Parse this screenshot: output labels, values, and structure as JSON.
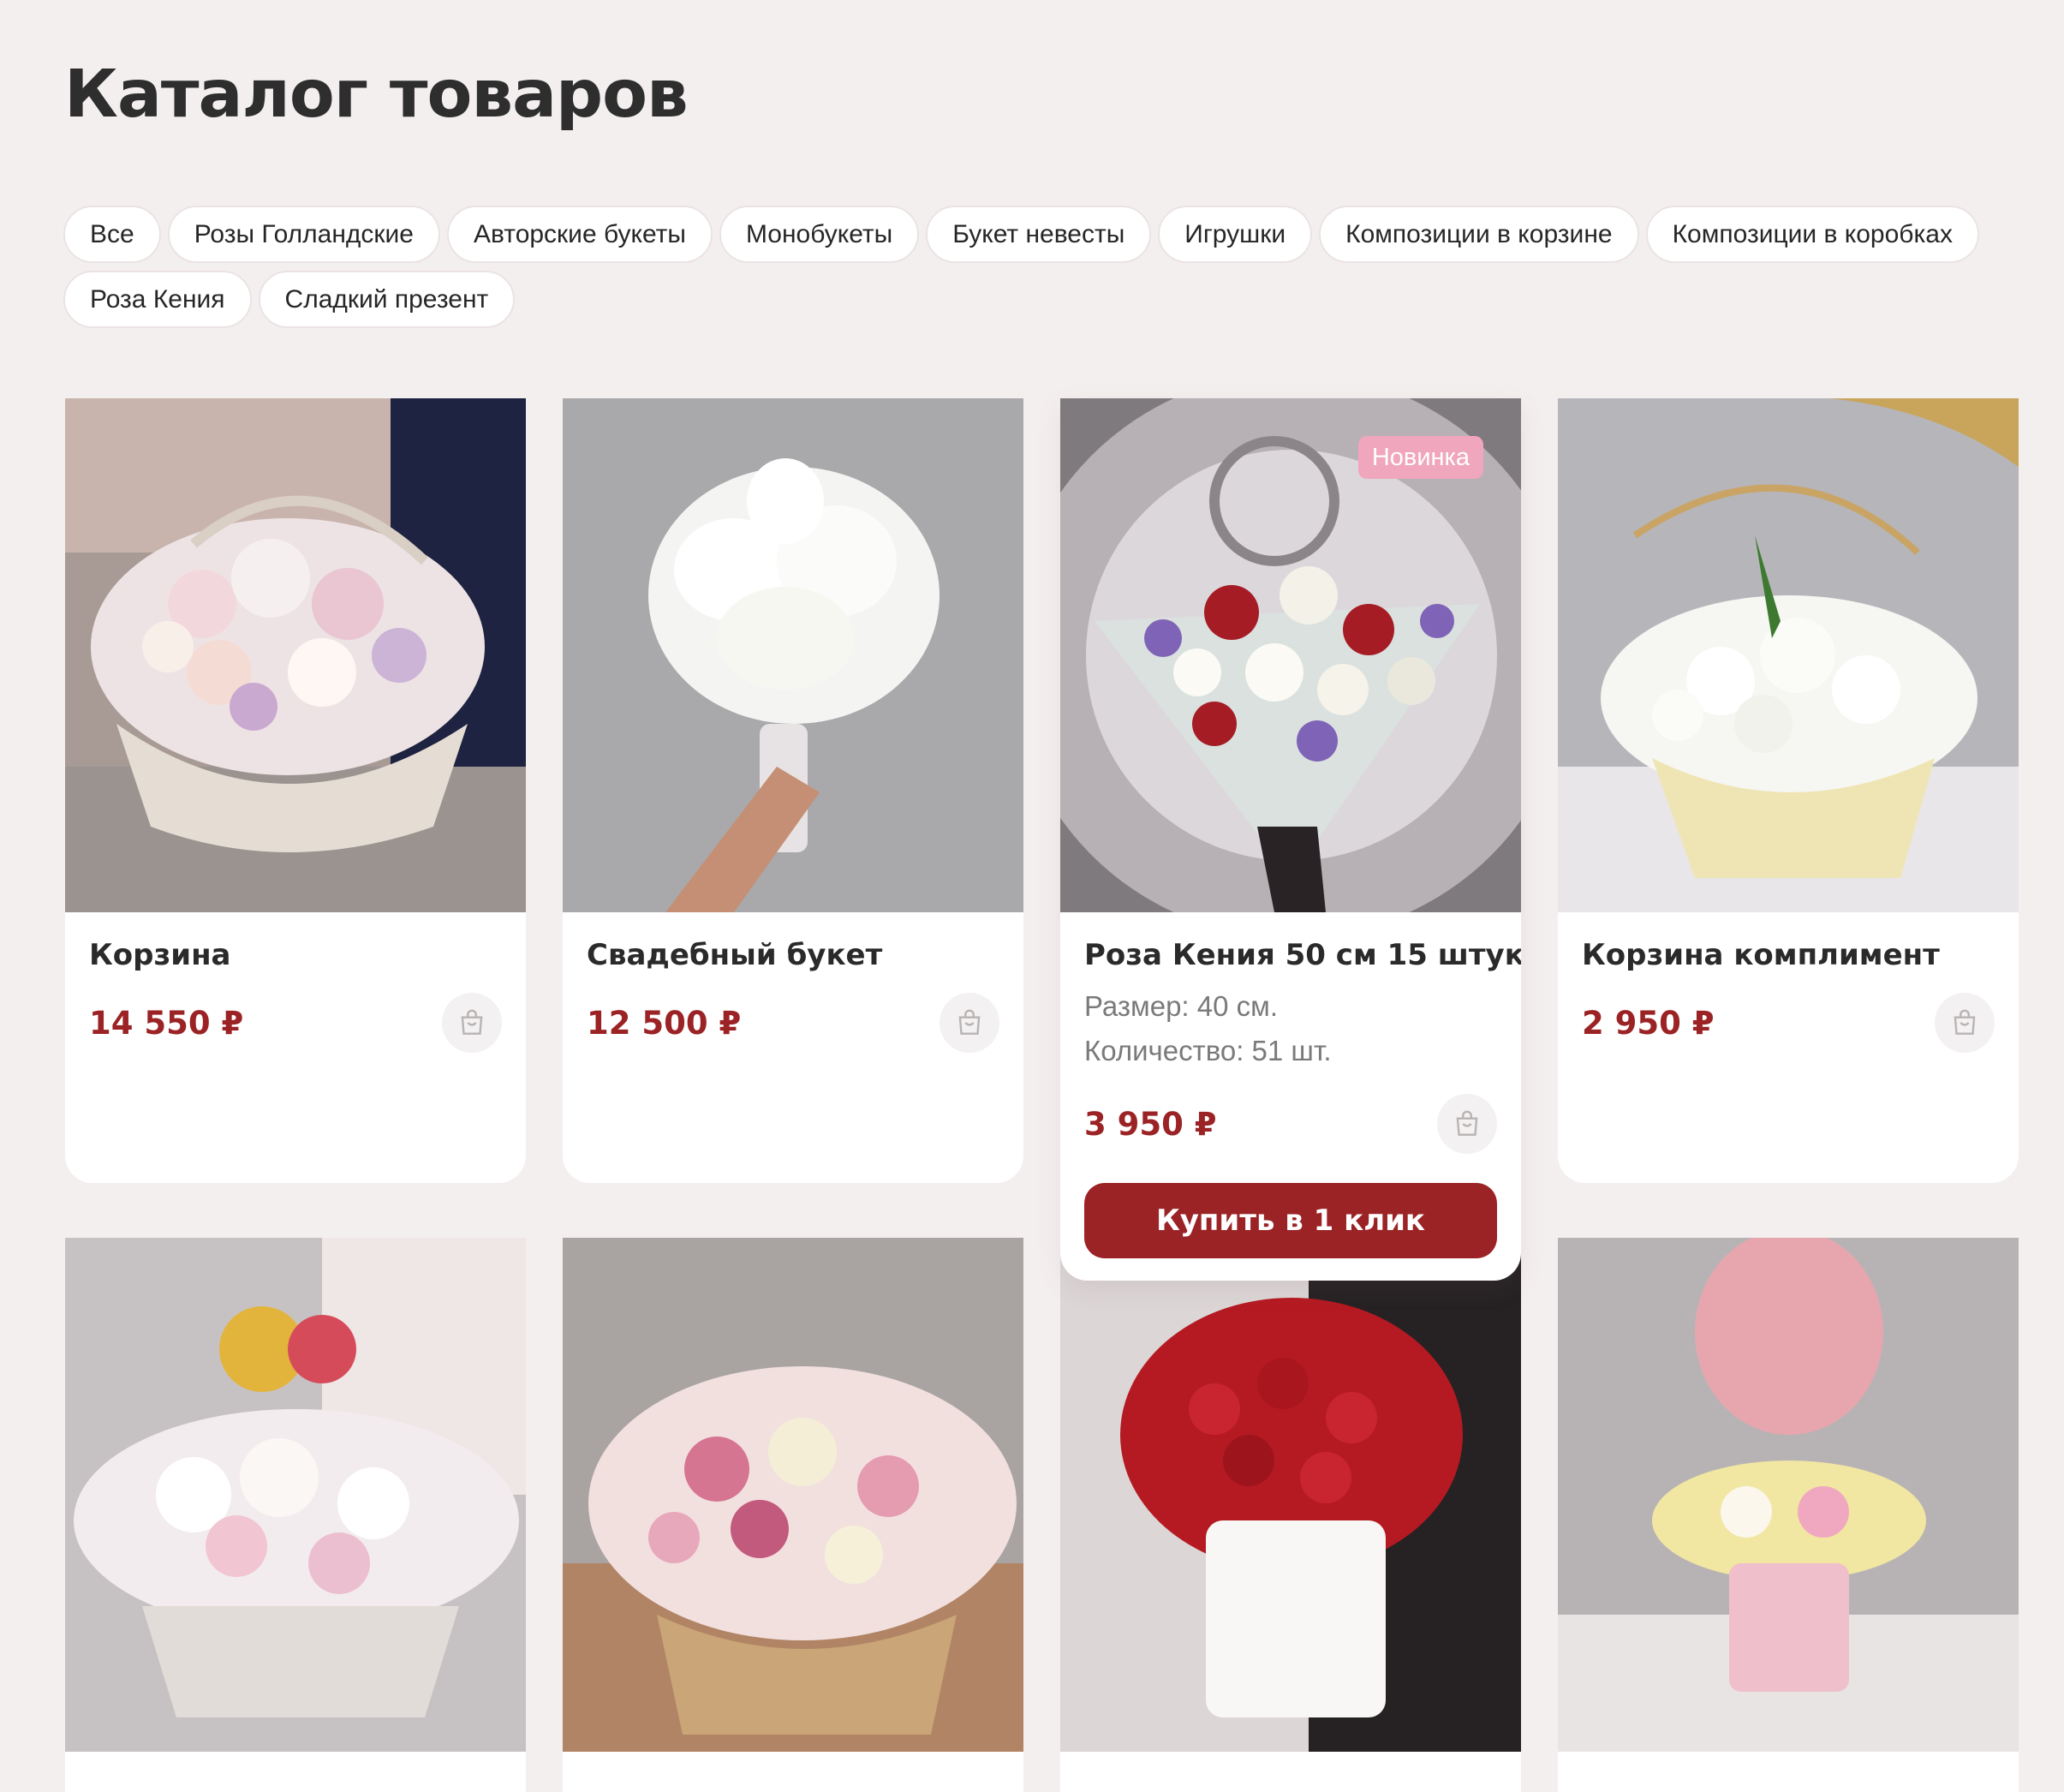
{
  "page": {
    "title": "Каталог товаров"
  },
  "filters": [
    "Все",
    "Розы Голландские",
    "Авторские букеты",
    "Монобукеты",
    "Букет невесты",
    "Игрушки",
    "Композиции в корзине",
    "Композиции в коробках",
    "Роза Кения",
    "Сладкий презент"
  ],
  "products": [
    {
      "name": "Корзина",
      "price": "14 550 ₽"
    },
    {
      "name": "Свадебный букет",
      "price": "12 500 ₽"
    },
    {
      "name": "Роза Кения 50 см 15 штук",
      "price": "3 950 ₽",
      "badge": "Новинка",
      "spec1": "Размер: 40 см.",
      "spec2": "Количество: 51 шт.",
      "buy_label": "Купить в 1 клик"
    },
    {
      "name": "Корзина комплимент",
      "price": "2 950 ₽"
    }
  ],
  "colors": {
    "accent": "#9b2325",
    "badge": "#f0a6bd",
    "background": "#f4efef"
  },
  "icons": {
    "cart": "shopping-bag-icon"
  }
}
